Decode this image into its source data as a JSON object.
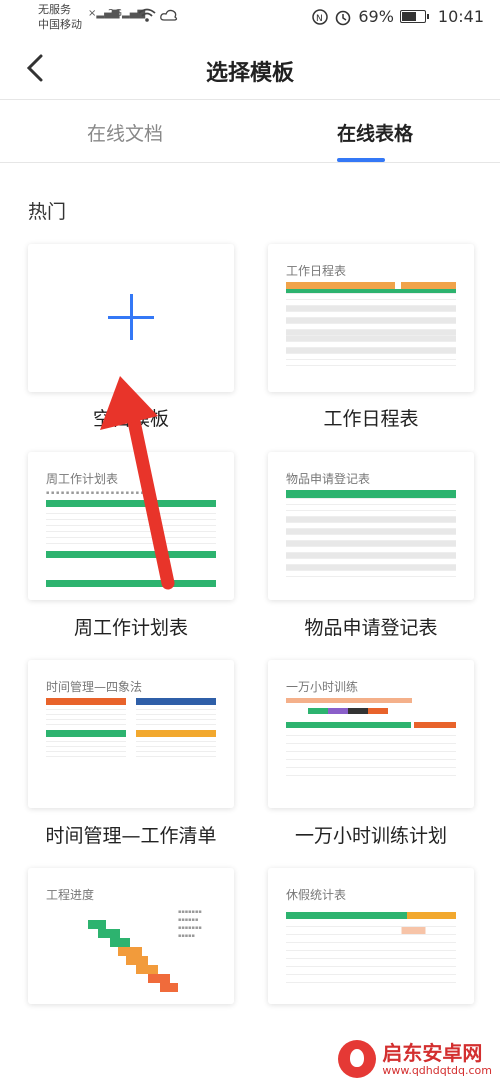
{
  "status_bar": {
    "carrier_line1": "无服务",
    "carrier_line2": "中国移动",
    "network": "2G",
    "battery": "69%",
    "battery_level": 0.69,
    "time": "10:41"
  },
  "nav": {
    "title": "选择模板",
    "back_icon": "chevron-left-icon"
  },
  "tabs": [
    {
      "label": "在线文档",
      "active": false
    },
    {
      "label": "在线表格",
      "active": true
    }
  ],
  "section": {
    "title": "热门"
  },
  "templates": [
    {
      "label": "空白模板",
      "title": ""
    },
    {
      "label": "工作日程表",
      "title": "工作日程表"
    },
    {
      "label": "周工作计划表",
      "title": "周工作计划表"
    },
    {
      "label": "物品申请登记表",
      "title": "物品申请登记表"
    },
    {
      "label": "时间管理—工作清单",
      "title": "时间管理—四象法"
    },
    {
      "label": "一万小时训练计划",
      "title": "一万小时训练"
    },
    {
      "label": "",
      "title": "工程进度"
    },
    {
      "label": "",
      "title": "休假统计表"
    }
  ],
  "colors": {
    "accent": "#3478f6",
    "green": "#2db36f",
    "arrow": "#e8342a"
  },
  "watermark": {
    "line1": "启东安卓网",
    "line2": "www.qdhdqtdq.com"
  }
}
